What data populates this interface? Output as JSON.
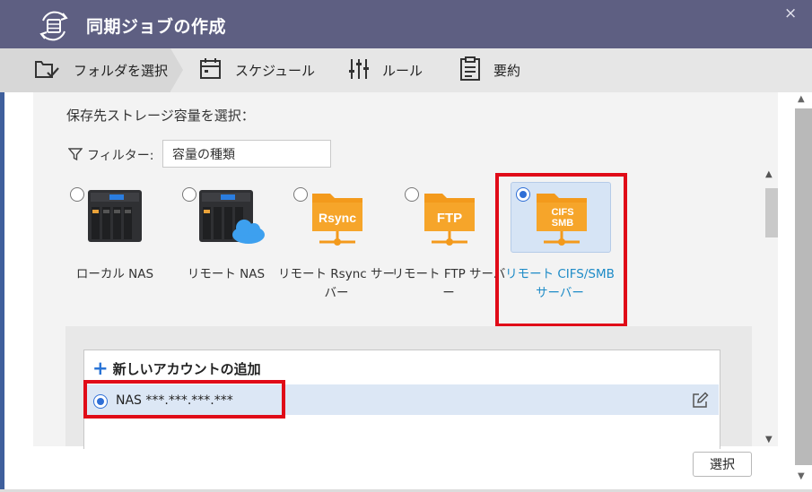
{
  "window": {
    "title": "同期ジョブの作成",
    "close_glyph": "×"
  },
  "steps": [
    {
      "label": "フォルダを選択",
      "icon": "folder-check-icon",
      "active": true
    },
    {
      "label": "スケジュール",
      "icon": "calendar-icon"
    },
    {
      "label": "ルール",
      "icon": "sliders-icon"
    },
    {
      "label": "要約",
      "icon": "clipboard-icon"
    }
  ],
  "main": {
    "heading": "保存先ストレージ容量を選択：",
    "filter": {
      "label": "フィルター:",
      "value": "容量の種類"
    },
    "storage_types": [
      {
        "label": "ローカル NAS",
        "icon": "nas-device-icon"
      },
      {
        "label": "リモート NAS",
        "icon": "nas-cloud-icon"
      },
      {
        "label": "リモート Rsync サーバー",
        "icon": "rsync-folder-icon",
        "badge": "Rsync"
      },
      {
        "label": "リモート FTP サーバー",
        "icon": "ftp-folder-icon",
        "badge": "FTP"
      },
      {
        "label": "リモート CIFS/SMB サーバー",
        "icon": "cifs-folder-icon",
        "badge_line1": "CIFS",
        "badge_line2": "SMB",
        "selected": true
      }
    ],
    "accounts": {
      "add_label": "新しいアカウントの追加",
      "items": [
        {
          "label": "NAS ***.***.***.***",
          "selected": true
        }
      ]
    }
  },
  "footer": {
    "select_button": "選択"
  },
  "colors": {
    "titlebar": "#5e5f82",
    "accent": "#2f6fd6",
    "folder_orange": "#f39a1c",
    "highlight_red": "#e00b18",
    "selected_label": "#1d8bc7"
  }
}
